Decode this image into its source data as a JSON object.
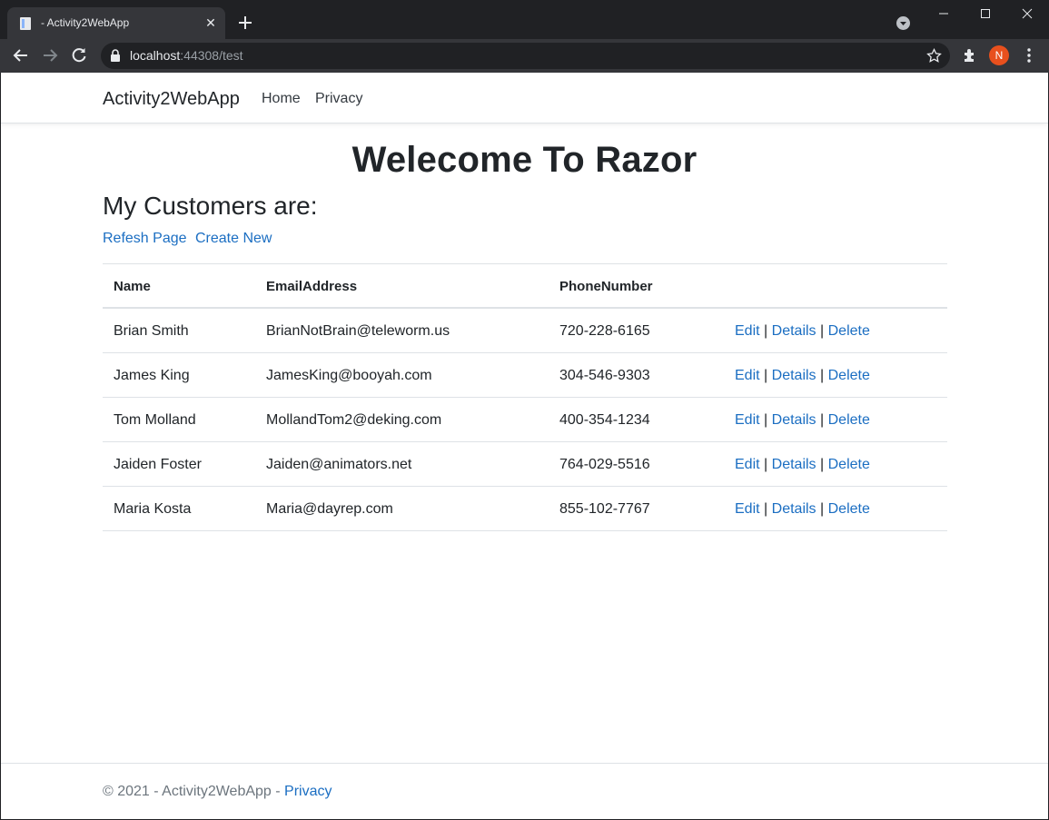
{
  "browser": {
    "tab_title": "- Activity2WebApp",
    "url_host": "localhost",
    "url_rest": ":44308/test",
    "profile_initial": "N",
    "accent_color": "#e8501d"
  },
  "nav": {
    "brand": "Activity2WebApp",
    "links": [
      "Home",
      "Privacy"
    ]
  },
  "page": {
    "heading": "Welecome To Razor",
    "subheading": "My Customers are:",
    "actions": [
      "Refesh Page",
      "Create New"
    ]
  },
  "table": {
    "headers": [
      "Name",
      "EmailAddress",
      "PhoneNumber",
      ""
    ],
    "rows": [
      {
        "name": "Brian Smith",
        "email": "BrianNotBrain@teleworm.us",
        "phone": "720-228-6165"
      },
      {
        "name": "James King",
        "email": "JamesKing@booyah.com",
        "phone": "304-546-9303"
      },
      {
        "name": "Tom Molland",
        "email": "MollandTom2@deking.com",
        "phone": "400-354-1234"
      },
      {
        "name": "Jaiden Foster",
        "email": "Jaiden@animators.net",
        "phone": "764-029-5516"
      },
      {
        "name": "Maria Kosta",
        "email": "Maria@dayrep.com",
        "phone": "855-102-7767"
      }
    ],
    "row_actions": {
      "edit": "Edit",
      "details": "Details",
      "delete": "Delete",
      "separator": "|"
    }
  },
  "footer": {
    "text": "© 2021 - Activity2WebApp - ",
    "link": "Privacy"
  }
}
